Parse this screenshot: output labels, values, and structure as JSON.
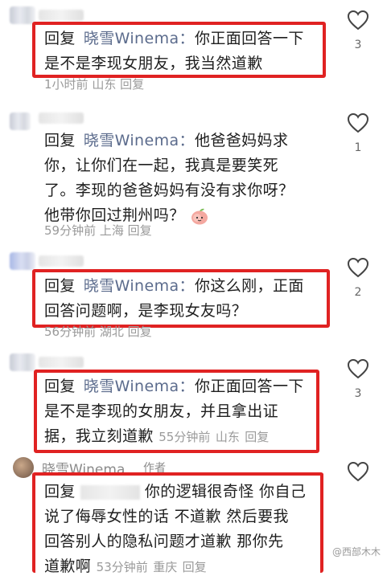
{
  "comments": [
    {
      "reply_word": "回复",
      "reply_to": "晓雪Winema：",
      "line1": "你正面回答一下",
      "line2": "是不是李现女朋友，我当然道歉",
      "time": "1小时前",
      "location": "山东",
      "reply_action": "回复",
      "likes": "3"
    },
    {
      "reply_word": "回复",
      "reply_to": "晓雪Winema：",
      "line1": "他爸爸妈妈求",
      "line2": "你，让你们在一起，我真是要笑死",
      "line3": "了。李现的爸爸妈妈有没有求你呀？",
      "line4": "他带你回过荆州吗？",
      "emoji": "peach-emoji",
      "time": "59分钟前",
      "location": "上海",
      "reply_action": "回复",
      "likes": "1"
    },
    {
      "reply_word": "回复",
      "reply_to": "晓雪Winema：",
      "line1": "你这么刚，正面",
      "line2": "回答问题啊，是李现女友吗？",
      "time": "56分钟前",
      "location": "湖北",
      "reply_action": "回复",
      "likes": "2"
    },
    {
      "reply_word": "回复",
      "reply_to": "晓雪Winema：",
      "line1": "你正面回答一下",
      "line2": "是不是李现的女朋友，并且拿出证",
      "line3": "据，我立刻道歉",
      "time": "55分钟前",
      "location": "山东",
      "reply_action": "回复",
      "likes": "3"
    },
    {
      "author": "晓雪Winema",
      "author_tag": "作者",
      "reply_word": "回复",
      "line1": "你的逻辑很奇怪 你自己",
      "line2": "说了侮辱女性的话 不道歉 然后要我",
      "line3": "回答别人的隐私问题才道歉 那你先",
      "line4": "道歉啊",
      "time": "53分钟前",
      "location": "重庆",
      "reply_action": "回复"
    }
  ],
  "watermark": "@西部木木",
  "colors": {
    "highlight_border": "#e02222",
    "meta_text": "#9a9a9a"
  },
  "icons": {
    "like": "heart-outline-icon"
  }
}
